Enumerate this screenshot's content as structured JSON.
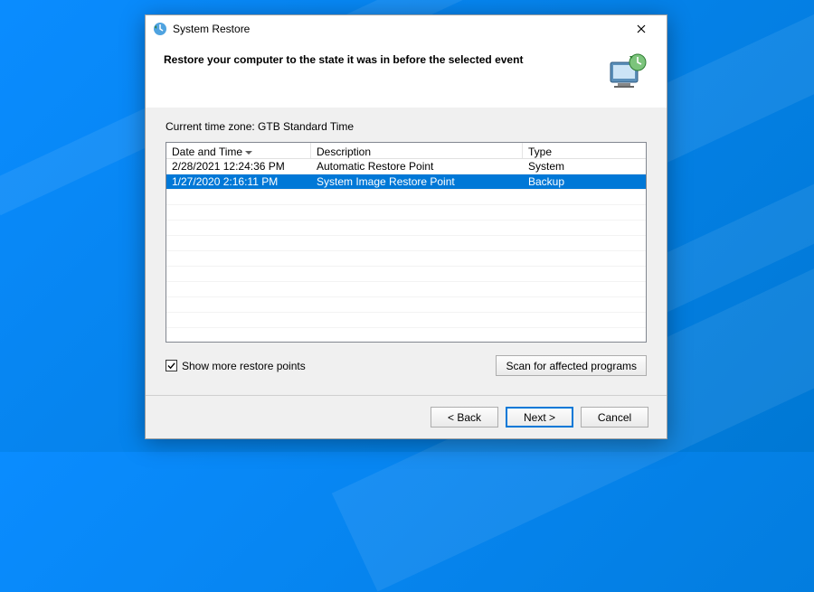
{
  "window": {
    "title": "System Restore"
  },
  "header": {
    "heading": "Restore your computer to the state it was in before the selected event"
  },
  "timezone_prefix": "Current time zone: ",
  "timezone_value": "GTB Standard Time",
  "table": {
    "columns": {
      "date_time": "Date and Time",
      "description": "Description",
      "type": "Type"
    },
    "rows": [
      {
        "date_time": "2/28/2021 12:24:36 PM",
        "description": "Automatic Restore Point",
        "type": "System",
        "selected": false
      },
      {
        "date_time": "1/27/2020 2:16:11 PM",
        "description": "System Image Restore Point",
        "type": "Backup",
        "selected": true
      }
    ]
  },
  "checkbox": {
    "label": "Show more restore points",
    "checked": true
  },
  "buttons": {
    "scan": "Scan for affected programs",
    "back": "< Back",
    "next": "Next >",
    "cancel": "Cancel"
  }
}
